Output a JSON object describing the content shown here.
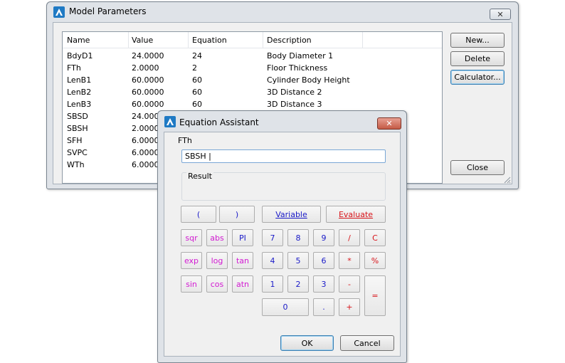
{
  "model_parameters": {
    "title": "Model Parameters",
    "close_glyph": "✕",
    "columns": [
      "Name",
      "Value",
      "Equation",
      "Description"
    ],
    "rows": [
      {
        "name": "BdyD1",
        "value": "24.0000",
        "equation": "24",
        "description": "Body Diameter 1"
      },
      {
        "name": "FTh",
        "value": "2.0000",
        "equation": "2",
        "description": "Floor Thickness"
      },
      {
        "name": "LenB1",
        "value": "60.0000",
        "equation": "60",
        "description": "Cylinder Body Height"
      },
      {
        "name": "LenB2",
        "value": "60.0000",
        "equation": "60",
        "description": "3D Distance 2"
      },
      {
        "name": "LenB3",
        "value": "60.0000",
        "equation": "60",
        "description": "3D Distance 3"
      },
      {
        "name": "SBSD",
        "value": "24.0000",
        "equation": "",
        "description": ""
      },
      {
        "name": "SBSH",
        "value": "2.0000",
        "equation": "",
        "description": ""
      },
      {
        "name": "SFH",
        "value": "6.0000",
        "equation": "",
        "description": ""
      },
      {
        "name": "SVPC",
        "value": "6.0000",
        "equation": "",
        "description": ""
      },
      {
        "name": "WTh",
        "value": "6.0000",
        "equation": "",
        "description": ""
      }
    ],
    "buttons": {
      "new_label": "New...",
      "delete_label": "Delete",
      "calculator_label": "Calculator...",
      "close_label": "Close"
    }
  },
  "equation_assistant": {
    "title": "Equation Assistant",
    "close_glyph": "✕",
    "parameter_name": "FTh",
    "expression_value": "SBSH |",
    "result_label": "Result",
    "result_value": "",
    "buttons": {
      "open_paren": "(",
      "close_paren": ")",
      "variable": "Variable",
      "evaluate": "Evaluate",
      "sqr": "sqr",
      "abs": "abs",
      "pi": "PI",
      "exp": "exp",
      "log": "log",
      "tan": "tan",
      "sin": "sin",
      "cos": "cos",
      "atn": "atn",
      "d7": "7",
      "d8": "8",
      "d9": "9",
      "d4": "4",
      "d5": "5",
      "d6": "6",
      "d1": "1",
      "d2": "2",
      "d3": "3",
      "d0": "0",
      "dot": ".",
      "div": "/",
      "clear": "C",
      "mul": "*",
      "pct": "%",
      "minus": "-",
      "plus": "+",
      "equals": "=",
      "ok": "OK",
      "cancel": "Cancel"
    }
  },
  "colors": {
    "operator_red": "#d8141a",
    "digit_blue": "#1a1ac8",
    "function_magenta": "#d21ad2",
    "focus_blue": "#3c7fb1"
  }
}
